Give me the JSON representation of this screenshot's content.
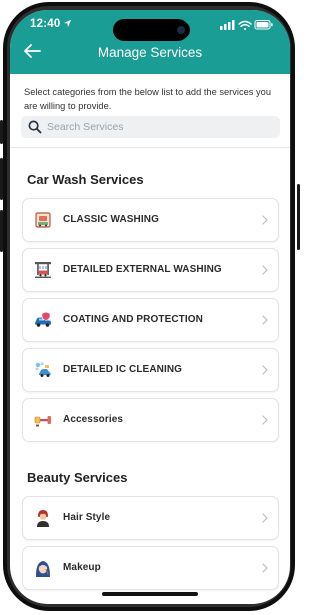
{
  "status_bar": {
    "time": "12:40"
  },
  "header": {
    "title": "Manage Services",
    "back_icon": "arrow-left-icon",
    "background_color": "#1a9d95"
  },
  "intro_text": "Select categories from the below list to add the services you are willing to provide.",
  "search": {
    "placeholder": "Search Services",
    "value": ""
  },
  "sections": [
    {
      "title": "Car Wash Services",
      "items": [
        {
          "label": "CLASSIC WASHING",
          "icon": "classic-washing-icon"
        },
        {
          "label": "DETAILED EXTERNAL WASHING",
          "icon": "external-washing-icon"
        },
        {
          "label": "COATING AND PROTECTION",
          "icon": "coating-icon"
        },
        {
          "label": "DETAILED IC CLEANING",
          "icon": "ic-cleaning-icon"
        },
        {
          "label": "Accessories",
          "icon": "accessories-icon"
        }
      ]
    },
    {
      "title": "Beauty Services",
      "items": [
        {
          "label": "Hair Style",
          "icon": "hair-style-icon"
        },
        {
          "label": "Makeup",
          "icon": "makeup-icon"
        }
      ]
    }
  ]
}
